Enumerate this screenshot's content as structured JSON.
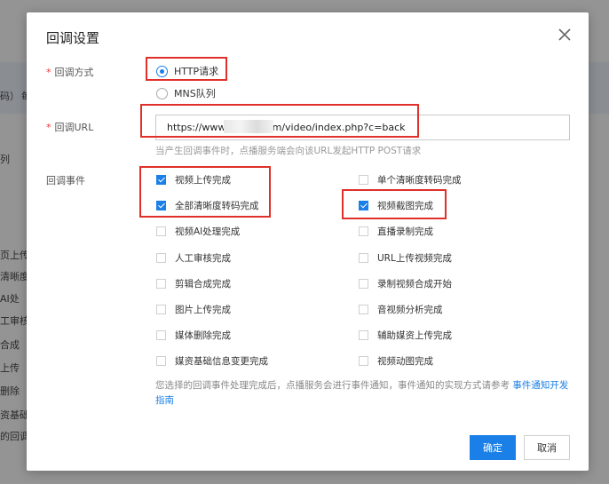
{
  "background": {
    "fragments": [
      "码）",
      "每",
      "列",
      "页上传",
      "清晰度",
      "AI处",
      "工审核",
      "合成",
      "上传",
      "删除",
      "资基础",
      "的回调"
    ]
  },
  "dialog": {
    "title": "回调设置",
    "close_icon": "close-icon",
    "callback_method": {
      "required_mark": "*",
      "label": "回调方式",
      "options": [
        {
          "label": "HTTP请求",
          "selected": true
        },
        {
          "label": "MNS队列",
          "selected": false
        }
      ]
    },
    "callback_url": {
      "required_mark": "*",
      "label": "回调URL",
      "value": "https://www             om/video/index.php?c=back",
      "hint": "当产生回调事件时，点播服务端会向该URL发起HTTP POST请求"
    },
    "callback_events": {
      "label": "回调事件",
      "left_column": [
        {
          "label": "视频上传完成",
          "checked": true
        },
        {
          "label": "全部清晰度转码完成",
          "checked": true
        },
        {
          "label": "视频AI处理完成",
          "checked": false
        },
        {
          "label": "人工审核完成",
          "checked": false
        },
        {
          "label": "剪辑合成完成",
          "checked": false
        },
        {
          "label": "图片上传完成",
          "checked": false
        },
        {
          "label": "媒体删除完成",
          "checked": false
        },
        {
          "label": "媒资基础信息变更完成",
          "checked": false
        }
      ],
      "right_column": [
        {
          "label": "单个清晰度转码完成",
          "checked": false
        },
        {
          "label": "视频截图完成",
          "checked": true
        },
        {
          "label": "直播录制完成",
          "checked": false
        },
        {
          "label": "URL上传视频完成",
          "checked": false
        },
        {
          "label": "录制视频合成开始",
          "checked": false
        },
        {
          "label": "音视频分析完成",
          "checked": false
        },
        {
          "label": "辅助媒资上传完成",
          "checked": false
        },
        {
          "label": "视频动图完成",
          "checked": false
        }
      ]
    },
    "note": {
      "text": "您选择的回调事件处理完成后，点播服务会进行事件通知，事件通知的实现方式请参考 ",
      "link": "事件通知开发指南"
    },
    "buttons": {
      "confirm": "确定",
      "cancel": "取消"
    }
  },
  "colors": {
    "primary": "#1a7fe6",
    "highlight": "#e0302a",
    "required": "#ee3333"
  }
}
